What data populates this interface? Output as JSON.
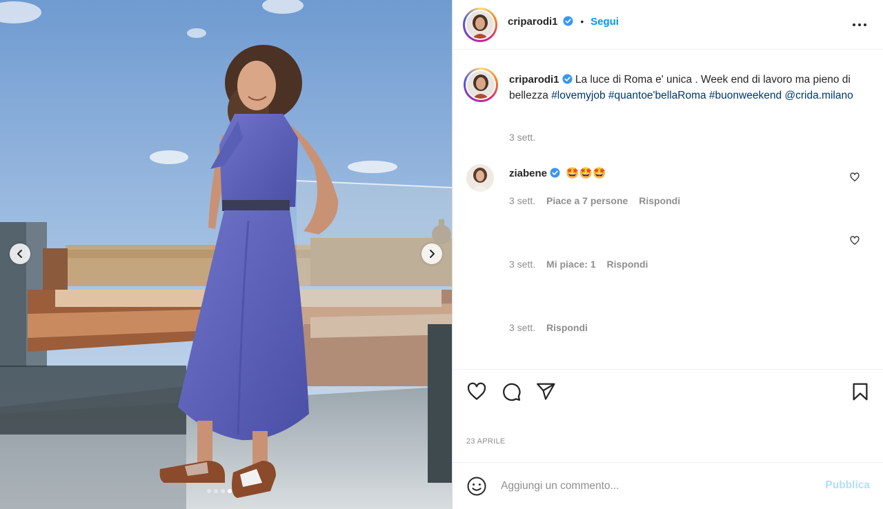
{
  "colors": {
    "accent": "#0095f6",
    "hashtag": "#00376b",
    "muted": "#8e8e8e",
    "publish_disabled": "#b2dffc"
  },
  "header": {
    "username": "criparodi1",
    "follow_label": "Segui",
    "separator": "•",
    "more_icon": "more-horizontal-icon"
  },
  "caption": {
    "username": "criparodi1",
    "text_1": "La luce di Roma e' unica . Week end di lavoro ma pieno di bellezza",
    "hashtag_1": "#lovemyjob",
    "hashtag_2": "#quantoe'bellaRoma",
    "hashtag_3": "#buonweekend",
    "mention": "@crida.milano",
    "time": "3 sett."
  },
  "comments": [
    {
      "username": "ziabene",
      "text": "🤩🤩🤩",
      "time": "3 sett.",
      "likes": "Piace a 7 persone",
      "reply": "Rispondi"
    },
    {
      "username": "",
      "text": "",
      "time": "3 sett.",
      "likes": "Mi piace: 1",
      "reply": "Rispondi"
    },
    {
      "username": "",
      "text": "",
      "time": "3 sett.",
      "likes": "",
      "reply": "Rispondi"
    }
  ],
  "actions": {
    "like_icon": "heart-icon",
    "comment_icon": "comment-icon",
    "share_icon": "send-icon",
    "save_icon": "bookmark-icon"
  },
  "post_date": "23 aprile",
  "add_comment": {
    "placeholder": "Aggiungi un commento...",
    "publish_label": "Pubblica",
    "emoji_icon": "smiley-icon"
  },
  "carousel": {
    "total": 4,
    "current": 4
  }
}
